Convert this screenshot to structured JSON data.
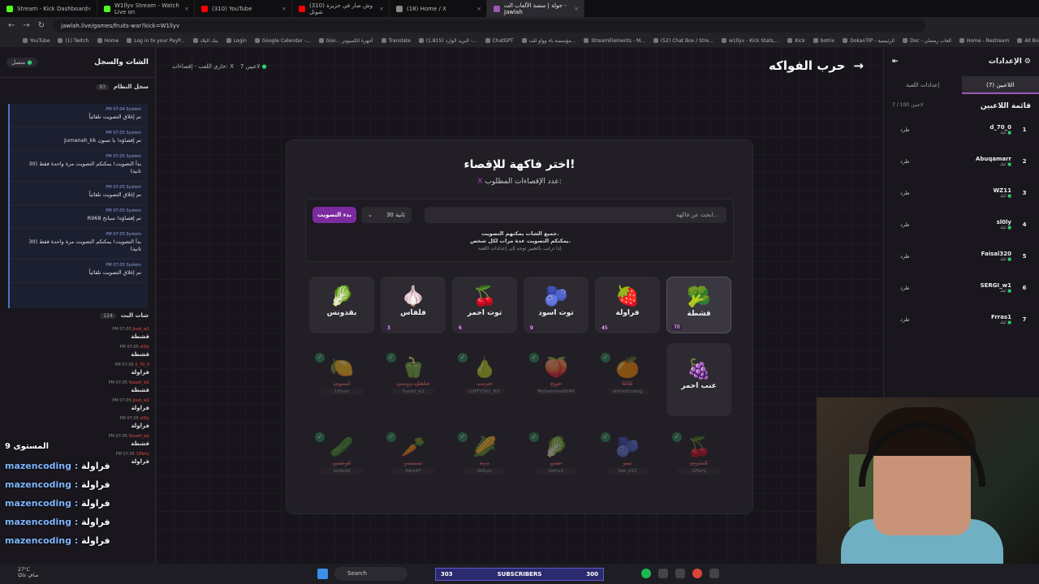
{
  "browser": {
    "tabs": [
      {
        "label": "Stream - Kick Dashboard",
        "color": "#53fc18"
      },
      {
        "label": "W1llyv Stream - Watch Live on",
        "color": "#53fc18"
      },
      {
        "label": "(310) YouTube",
        "color": "#ff0000"
      },
      {
        "label": "(310) وش صار في جزيرة شوتل",
        "color": "#ff0000"
      },
      {
        "label": "(18) Home / X",
        "color": "#888888"
      },
      {
        "label": "جولة | منصة الألعاب الت - Jawlah",
        "color": "#9b59b6"
      }
    ],
    "url": "jawlah.live/games/fruits-war?kick=W1llyv",
    "bookmarks": [
      "YouTube",
      "(1) Twitch",
      "Home",
      "Log in to your PayP...",
      "بنك البلاد",
      "Login",
      "Google Calendar -...",
      "Goo... أجهزة الكمبيوتر",
      "Translate",
      "(1,815) البريد الوارد -...",
      "ChatGPT",
      "مؤسسة باء وواو للت...",
      "StreamElements - M...",
      "(52) Chat Box / Stre...",
      "w1llyv - Kick Stats,...",
      "Kick",
      "botrix",
      "DokanTIP - الرئيسية",
      "Doc - العاب رمضان",
      "Home - Restream",
      "All Bookmarks"
    ]
  },
  "left_panel": {
    "title": "الشات والسجل",
    "status": "متصل",
    "system_log": {
      "title": "سجل النظام",
      "count": "93",
      "messages": [
        {
          "time": "PM 07:04",
          "sender": "System",
          "text": "تم إغلاق التصويت تلقائياً"
        },
        {
          "time": "PM 07:05",
          "sender": "System",
          "text": "Jumanah_kk تم إقصاؤه! يا نسون"
        },
        {
          "time": "PM 07:05",
          "sender": "System",
          "text": "بدأ التصويت! يمكنكم التصويت مرة واحدة فقط (30 ثانية)"
        },
        {
          "time": "PM 07:05",
          "sender": "System",
          "text": "تم إغلاق التصويت تلقائياً"
        },
        {
          "time": "PM 07:05",
          "sender": "System",
          "text": "R968 تم إقصاؤه! سبانخ"
        },
        {
          "time": "PM 07:05",
          "sender": "System",
          "text": "بدأ التصويت! يمكنكم التصويت مرة واحدة فقط (30 ثانية)"
        },
        {
          "time": "PM 07:05",
          "sender": "System",
          "text": "تم إغلاق التصويت تلقائياً"
        }
      ]
    },
    "stream_chat": {
      "title": "شات البث",
      "count": "124",
      "messages": [
        {
          "time": "PM 07:05",
          "user": "Joud_w1",
          "text": "قشطة"
        },
        {
          "time": "PM 07:05",
          "user": "sl0ly",
          "text": "قشطة"
        },
        {
          "time": "PM 07:05",
          "user": "d_70_0",
          "text": "فراولة"
        },
        {
          "time": "PM 07:05",
          "user": "Yussef_w1",
          "text": "قشطة"
        },
        {
          "time": "PM 07:05",
          "user": "Joud_w1",
          "text": "فراولة"
        },
        {
          "time": "PM 07:05",
          "user": "sl0ly",
          "text": "فراولة"
        },
        {
          "time": "PM 07:05",
          "user": "Yussef_w1",
          "text": "قشطة"
        },
        {
          "time": "PM 07:05",
          "user": "1iFairy",
          "text": "فراولة"
        }
      ]
    }
  },
  "overlay_chat": {
    "header": "المستوى 9",
    "lines": [
      {
        "user": "mazencoding",
        "text": "فراولة"
      },
      {
        "user": "mazencoding",
        "text": "فراولة"
      },
      {
        "user": "mazencoding",
        "text": "فراولة"
      },
      {
        "user": "mazencoding",
        "text": "فراولة"
      },
      {
        "user": "mazencoding",
        "text": "فراولة"
      }
    ]
  },
  "game": {
    "status_players": "7 لاعبين",
    "status_text": "جاري اللعب - إقصاءات: X",
    "title": "حرب الفواكه",
    "card_title": "اختر فاكهة للإقصاء!",
    "eliminations_label": "عدد الإقصاءات المطلوب:",
    "eliminations_value": "X",
    "search_placeholder": "ابحث عن فاكهة...",
    "timer": "30 ثانية",
    "start_vote": "بدء التصويت",
    "info_line1": "جميع الشات يمكنهم التصويت.",
    "info_line2": "يمكنكم التصويت عدة مرات لكل شخص.",
    "info_hint": "إذا ترغب بالتغيير توجه إلى إعدادات اللعبة.",
    "active_fruits": [
      {
        "name": "قشطة",
        "emoji": "🥦",
        "votes": "70",
        "selected": true
      },
      {
        "name": "فراولة",
        "emoji": "🍓",
        "votes": "45"
      },
      {
        "name": "توت اسود",
        "emoji": "🫐",
        "votes": "9"
      },
      {
        "name": "توت احمر",
        "emoji": "🍒",
        "votes": "6"
      },
      {
        "name": "فلفاس",
        "emoji": "🧄",
        "votes": "3"
      },
      {
        "name": "بقدونس",
        "emoji": "🥬",
        "votes": ""
      }
    ],
    "extra_fruit": {
      "name": "عنب احمر",
      "emoji": "🍇"
    },
    "eliminated_row1": [
      {
        "name": "كاكا",
        "emoji": "🍊",
        "player": "ahmedcoding"
      },
      {
        "name": "خوخ",
        "emoji": "🍑",
        "player": "Mohammed0rAll"
      },
      {
        "name": "جريب",
        "emoji": "🍐",
        "player": "LUFFY561_W1"
      },
      {
        "name": "فلفل رومي",
        "emoji": "🫑",
        "player": "Yussef_w1"
      },
      {
        "name": "ليمون",
        "emoji": "🍋",
        "player": "1l0yvo"
      }
    ],
    "eliminated_row2": [
      {
        "name": "كمثرى",
        "emoji": "🍒",
        "player": "1iFairy"
      },
      {
        "name": "تمر",
        "emoji": "🫐",
        "player": "two_b52"
      },
      {
        "name": "خس",
        "emoji": "🥬",
        "player": "Idehx1"
      },
      {
        "name": "ذرة",
        "emoji": "🌽",
        "player": "W0Lyv"
      },
      {
        "name": "شمندر",
        "emoji": "🥕",
        "player": "Adrx47"
      },
      {
        "name": "كرفس",
        "emoji": "🥒",
        "player": "lardodd"
      }
    ]
  },
  "right_panel": {
    "title": "الإعدادات",
    "tab_players": "اللاعبين (7)",
    "tab_settings": "إعدادات اللعبة",
    "list_title": "قائمة اللاعبين",
    "list_count": "7 / 100 لاعبين",
    "kick_label": "طرد",
    "players": [
      {
        "num": "1",
        "name": "d_70_0",
        "platform": "كيك"
      },
      {
        "num": "2",
        "name": "Abuqamarr",
        "platform": "كيك"
      },
      {
        "num": "3",
        "name": "WZ11",
        "platform": "كيك"
      },
      {
        "num": "4",
        "name": "sl0ly",
        "platform": "كيك"
      },
      {
        "num": "5",
        "name": "Faisal320",
        "platform": "كيك"
      },
      {
        "num": "6",
        "name": "SERGI_w1",
        "platform": "كيك"
      },
      {
        "num": "7",
        "name": "Frras1",
        "platform": "كيك"
      }
    ]
  },
  "taskbar": {
    "temp": "27°C",
    "weather": "صافٍ غالبًا",
    "search": "Search",
    "subs_left": "303",
    "subs_label": "SUBSCRIBERS",
    "subs_right": "300"
  }
}
